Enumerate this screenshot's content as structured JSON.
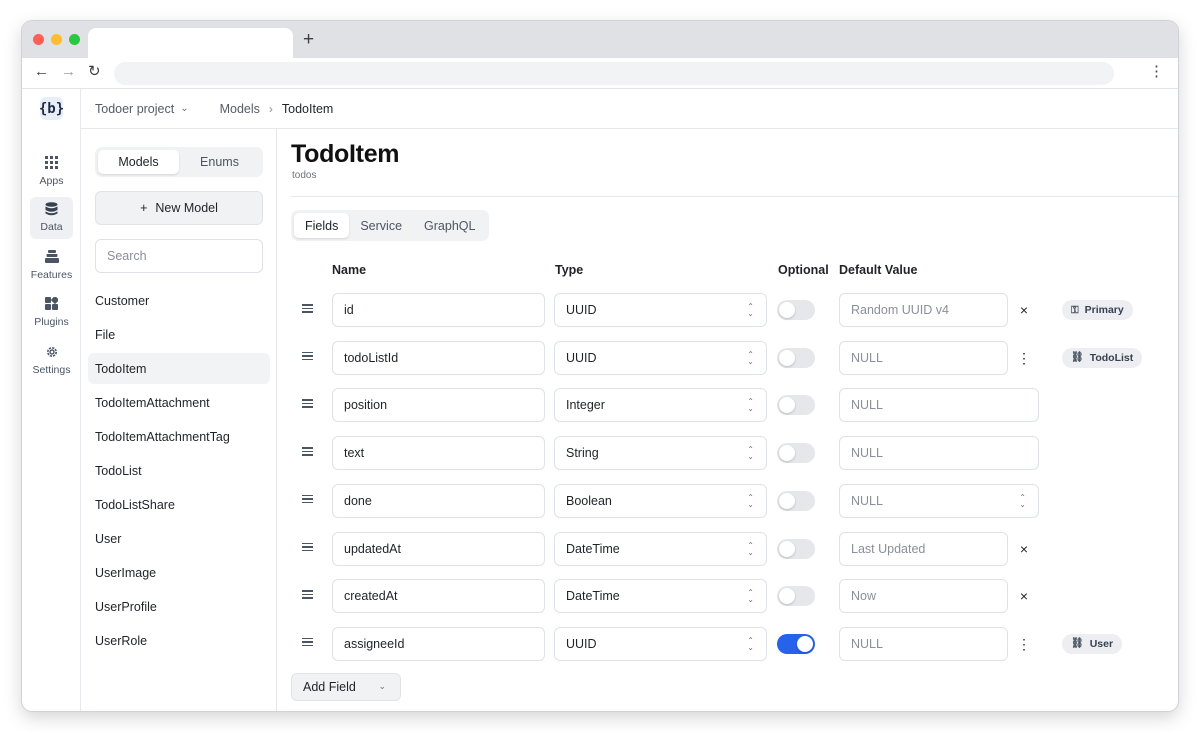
{
  "browser": {
    "new_tab_icon": "plus-icon",
    "back_icon": "arrow-left-icon",
    "forward_icon": "arrow-right-icon",
    "reload_icon": "reload-icon",
    "menu_icon": "vertical-dots-icon"
  },
  "app": {
    "logo_glyph": "{b}"
  },
  "rail": {
    "items": [
      {
        "label": "Apps",
        "icon": "grid-icon"
      },
      {
        "label": "Data",
        "icon": "database-icon"
      },
      {
        "label": "Features",
        "icon": "layers-icon"
      },
      {
        "label": "Plugins",
        "icon": "puzzle-icon"
      },
      {
        "label": "Settings",
        "icon": "gear-icon"
      }
    ],
    "active": "Data"
  },
  "breadcrumb": {
    "project": "Todoer project",
    "section": "Models",
    "current": "TodoItem"
  },
  "models_panel": {
    "tabs": [
      "Models",
      "Enums"
    ],
    "active_tab": "Models",
    "new_model_label": "New Model",
    "search_placeholder": "Search",
    "models": [
      "Customer",
      "File",
      "TodoItem",
      "TodoItemAttachment",
      "TodoItemAttachmentTag",
      "TodoList",
      "TodoListShare",
      "User",
      "UserImage",
      "UserProfile",
      "UserRole"
    ],
    "active_model": "TodoItem"
  },
  "main": {
    "title": "TodoItem",
    "subtitle": "todos",
    "tabs": [
      "Fields",
      "Service",
      "GraphQL"
    ],
    "active_tab": "Fields",
    "columns": {
      "name": "Name",
      "type": "Type",
      "optional": "Optional",
      "default": "Default Value"
    },
    "fields": [
      {
        "name": "id",
        "type": "UUID",
        "optional": false,
        "default": "Random UUID v4",
        "default_is_placeholder": true,
        "action": "×",
        "badge": "Primary",
        "badge_icon": "key-icon"
      },
      {
        "name": "todoListId",
        "type": "UUID",
        "optional": false,
        "default": "NULL",
        "default_is_placeholder": true,
        "action": "⋮",
        "badge": "TodoList",
        "badge_icon": "link-icon"
      },
      {
        "name": "position",
        "type": "Integer",
        "optional": false,
        "default": "NULL",
        "default_is_placeholder": true
      },
      {
        "name": "text",
        "type": "String",
        "optional": false,
        "default": "NULL",
        "default_is_placeholder": true
      },
      {
        "name": "done",
        "type": "Boolean",
        "optional": false,
        "default": "NULL",
        "default_is_placeholder": true
      },
      {
        "name": "updatedAt",
        "type": "DateTime",
        "optional": false,
        "default": "Last Updated",
        "default_is_placeholder": true,
        "action": "×"
      },
      {
        "name": "createdAt",
        "type": "DateTime",
        "optional": false,
        "default": "Now",
        "default_is_placeholder": true,
        "action": "×"
      },
      {
        "name": "assigneeId",
        "type": "UUID",
        "optional": true,
        "default": "NULL",
        "default_is_placeholder": true,
        "action": "⋮",
        "badge": "User",
        "badge_icon": "link-icon"
      }
    ],
    "add_field_label": "Add Field"
  },
  "colors": {
    "accent": "#2563eb",
    "toggle_off": "#e5e7eb"
  }
}
